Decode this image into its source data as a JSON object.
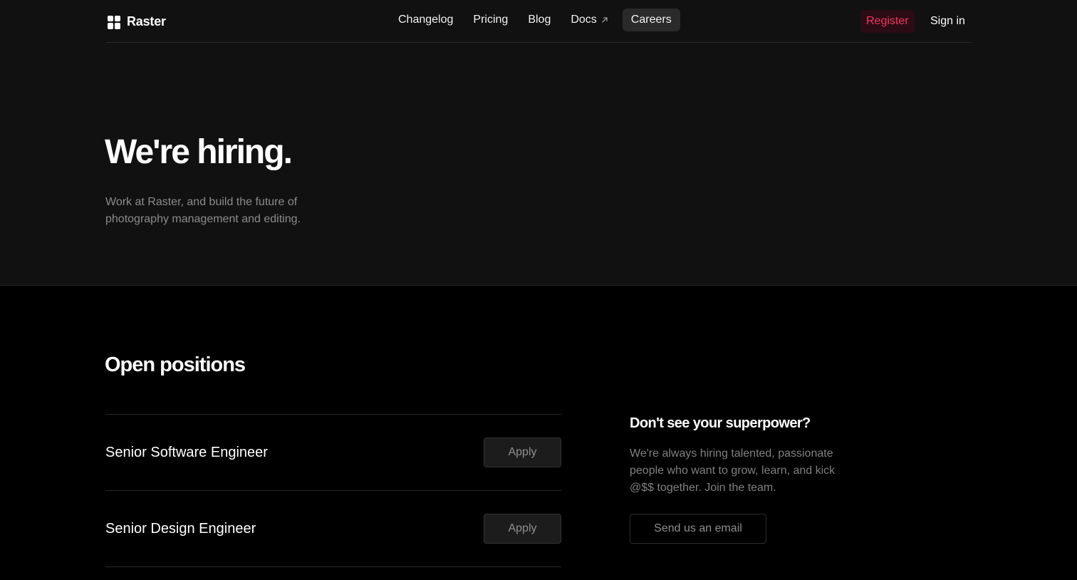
{
  "header": {
    "brand": "Raster",
    "nav": [
      {
        "label": "Changelog"
      },
      {
        "label": "Pricing"
      },
      {
        "label": "Blog"
      },
      {
        "label": "Docs",
        "icon": "external-arrow-icon"
      },
      {
        "label": "Careers",
        "active": true
      }
    ],
    "register_label": "Register",
    "signin_label": "Sign in"
  },
  "hero": {
    "title": "We're hiring.",
    "subtitle": "Work at Raster, and build the future of photography management and editing."
  },
  "positions": {
    "title": "Open positions",
    "items": [
      {
        "title": "Senior Software Engineer",
        "action": "Apply"
      },
      {
        "title": "Senior Design Engineer",
        "action": "Apply"
      }
    ]
  },
  "sidebar": {
    "title": "Don't see your superpower?",
    "text": "We're always hiring talented, passionate people who want to grow, learn, and kick @$$ together. Join the team.",
    "button_label": "Send us an email"
  },
  "colors": {
    "hero_background": "#111111",
    "page_background": "#000000",
    "register_text": "#f0355f",
    "register_background": "#2b0b14"
  }
}
